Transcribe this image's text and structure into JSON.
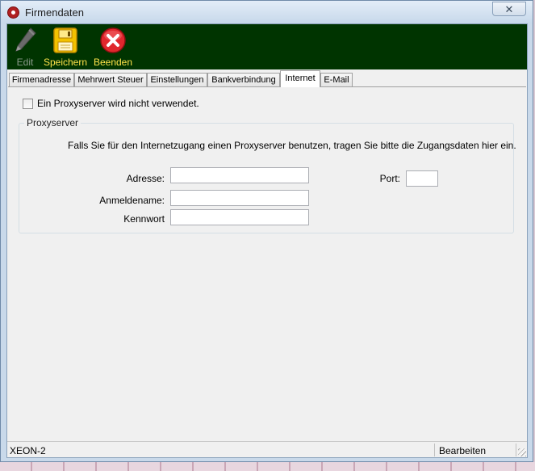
{
  "window": {
    "title": "Firmendaten",
    "close_glyph": "✕"
  },
  "toolbar": {
    "edit_label": "Edit",
    "save_label": "Speichern",
    "quit_label": "Beenden",
    "bg_color": "#003400",
    "label_color": "#ffe34a"
  },
  "tabs": [
    {
      "label": "Firmenadresse"
    },
    {
      "label": "Mehrwert Steuer"
    },
    {
      "label": "Einstellungen"
    },
    {
      "label": "Bankverbindung"
    },
    {
      "label": "Internet",
      "active": true
    },
    {
      "label": "E-Mail"
    }
  ],
  "internet": {
    "no_proxy_label": "Ein Proxyserver wird nicht verwendet.",
    "no_proxy_checked": false,
    "group_title": "Proxyserver",
    "description": "Falls Sie für den Internetzugang einen Proxyserver benutzen, tragen Sie bitte die Zugangsdaten hier ein.",
    "address_label": "Adresse:",
    "address_value": "",
    "port_label": "Port:",
    "port_value": "",
    "username_label": "Anmeldename:",
    "username_value": "",
    "password_label": "Kennwort",
    "password_value": ""
  },
  "statusbar": {
    "left": "XEON-2",
    "right": "Bearbeiten"
  }
}
